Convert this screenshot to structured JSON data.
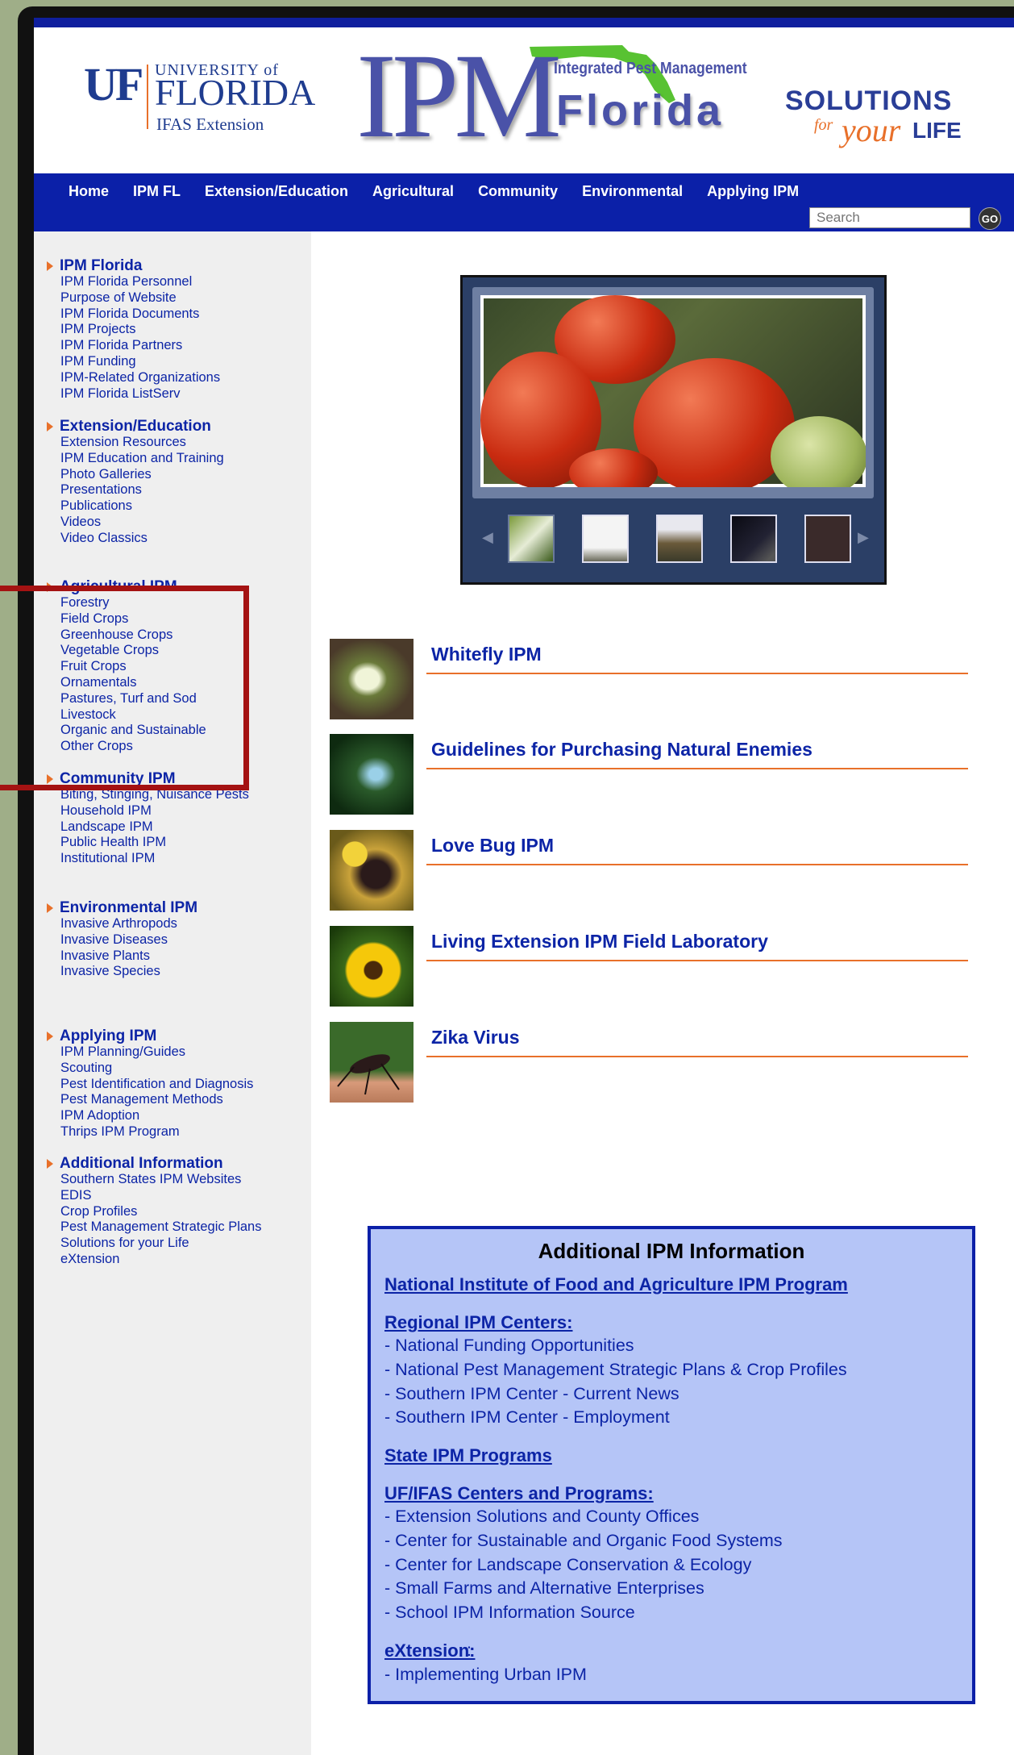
{
  "header": {
    "uf_mark": "UF",
    "uf_university": "UNIVERSITY of",
    "uf_florida": "FLORIDA",
    "uf_ifas": "IFAS Extension",
    "ipm_big": "IPM",
    "ipm_sub": "Integrated Pest Management",
    "ipm_florida": "Florida",
    "sol_top": "SOLUTIONS",
    "sol_for": "for",
    "sol_your": "your",
    "sol_life": "LIFE"
  },
  "nav": {
    "items": [
      "Home",
      "IPM FL",
      "Extension/Education",
      "Agricultural",
      "Community",
      "Environmental",
      "Applying IPM"
    ],
    "search_placeholder": "Search",
    "go_label": "GO"
  },
  "sidebar": {
    "sections": [
      {
        "title": "IPM Florida",
        "items": [
          "IPM Florida Personnel",
          "Purpose of Website",
          "IPM Florida Documents",
          "IPM Projects",
          "IPM Florida Partners",
          "IPM Funding",
          "IPM-Related Organizations",
          "IPM Florida ListServ"
        ]
      },
      {
        "title": "Extension/Education",
        "items": [
          "Extension Resources",
          "IPM Education and Training",
          "Photo Galleries",
          "Presentations",
          "Publications",
          "Videos",
          "Video Classics"
        ]
      },
      {
        "title": "Agricultural IPM",
        "items": [
          "Forestry",
          "Field Crops",
          "Greenhouse Crops",
          "Vegetable Crops",
          "Fruit Crops",
          "Ornamentals",
          "Pastures, Turf and Sod",
          "Livestock",
          "Organic and Sustainable",
          "Other Crops"
        ]
      },
      {
        "title": "Community IPM",
        "items": [
          "Biting, Stinging, Nuisance Pests",
          "Household IPM",
          "Landscape IPM",
          "Public Health IPM",
          "Institutional IPM"
        ]
      },
      {
        "title": "Environmental IPM",
        "items": [
          "Invasive Arthropods",
          "Invasive Diseases",
          "Invasive Plants",
          "Invasive Species"
        ]
      },
      {
        "title": "Applying IPM",
        "items": [
          "IPM Planning/Guides",
          "Scouting",
          "Pest Identification and Diagnosis",
          "Pest Management Methods",
          "IPM Adoption",
          "Thrips IPM Program"
        ]
      },
      {
        "title": "Additional Information",
        "items": [
          "Southern States IPM Websites",
          "EDIS",
          "Crop Profiles",
          "Pest Management Strategic Plans",
          "Solutions for your Life",
          "eXtension"
        ]
      }
    ]
  },
  "news": [
    {
      "title": "Whitefly IPM"
    },
    {
      "title": "Guidelines for Purchasing Natural Enemies"
    },
    {
      "title": "Love Bug IPM"
    },
    {
      "title": "Living Extension IPM Field Laboratory"
    },
    {
      "title": "Zika Virus"
    }
  ],
  "info": {
    "title": "Additional IPM Information",
    "nifa": "National Institute of Food and Agriculture IPM Program",
    "regional_heading": "Regional IPM Centers:",
    "regional_items": [
      "- National Funding Opportunities",
      "- National Pest Management Strategic Plans & Crop Profiles",
      "- Southern IPM Center - Current News",
      "- Southern IPM Center - Employment"
    ],
    "state": "State IPM Programs",
    "ufifas_heading": "UF/IFAS Centers and Programs:",
    "ufifas_items": [
      "- Extension Solutions and County Offices",
      "- Center for Sustainable and Organic Food Systems",
      "- Center for Landscape Conservation & Ecology",
      "- Small Farms and Alternative Enterprises",
      "- School IPM Information Source"
    ],
    "extension_heading": "eXtension:",
    "extension_colon": ":",
    "extension_items": [
      "- Implementing Urban IPM"
    ]
  },
  "colors": {
    "brand_blue": "#0b20a8",
    "accent_orange": "#e8702a",
    "highlight_red": "#a41212"
  }
}
